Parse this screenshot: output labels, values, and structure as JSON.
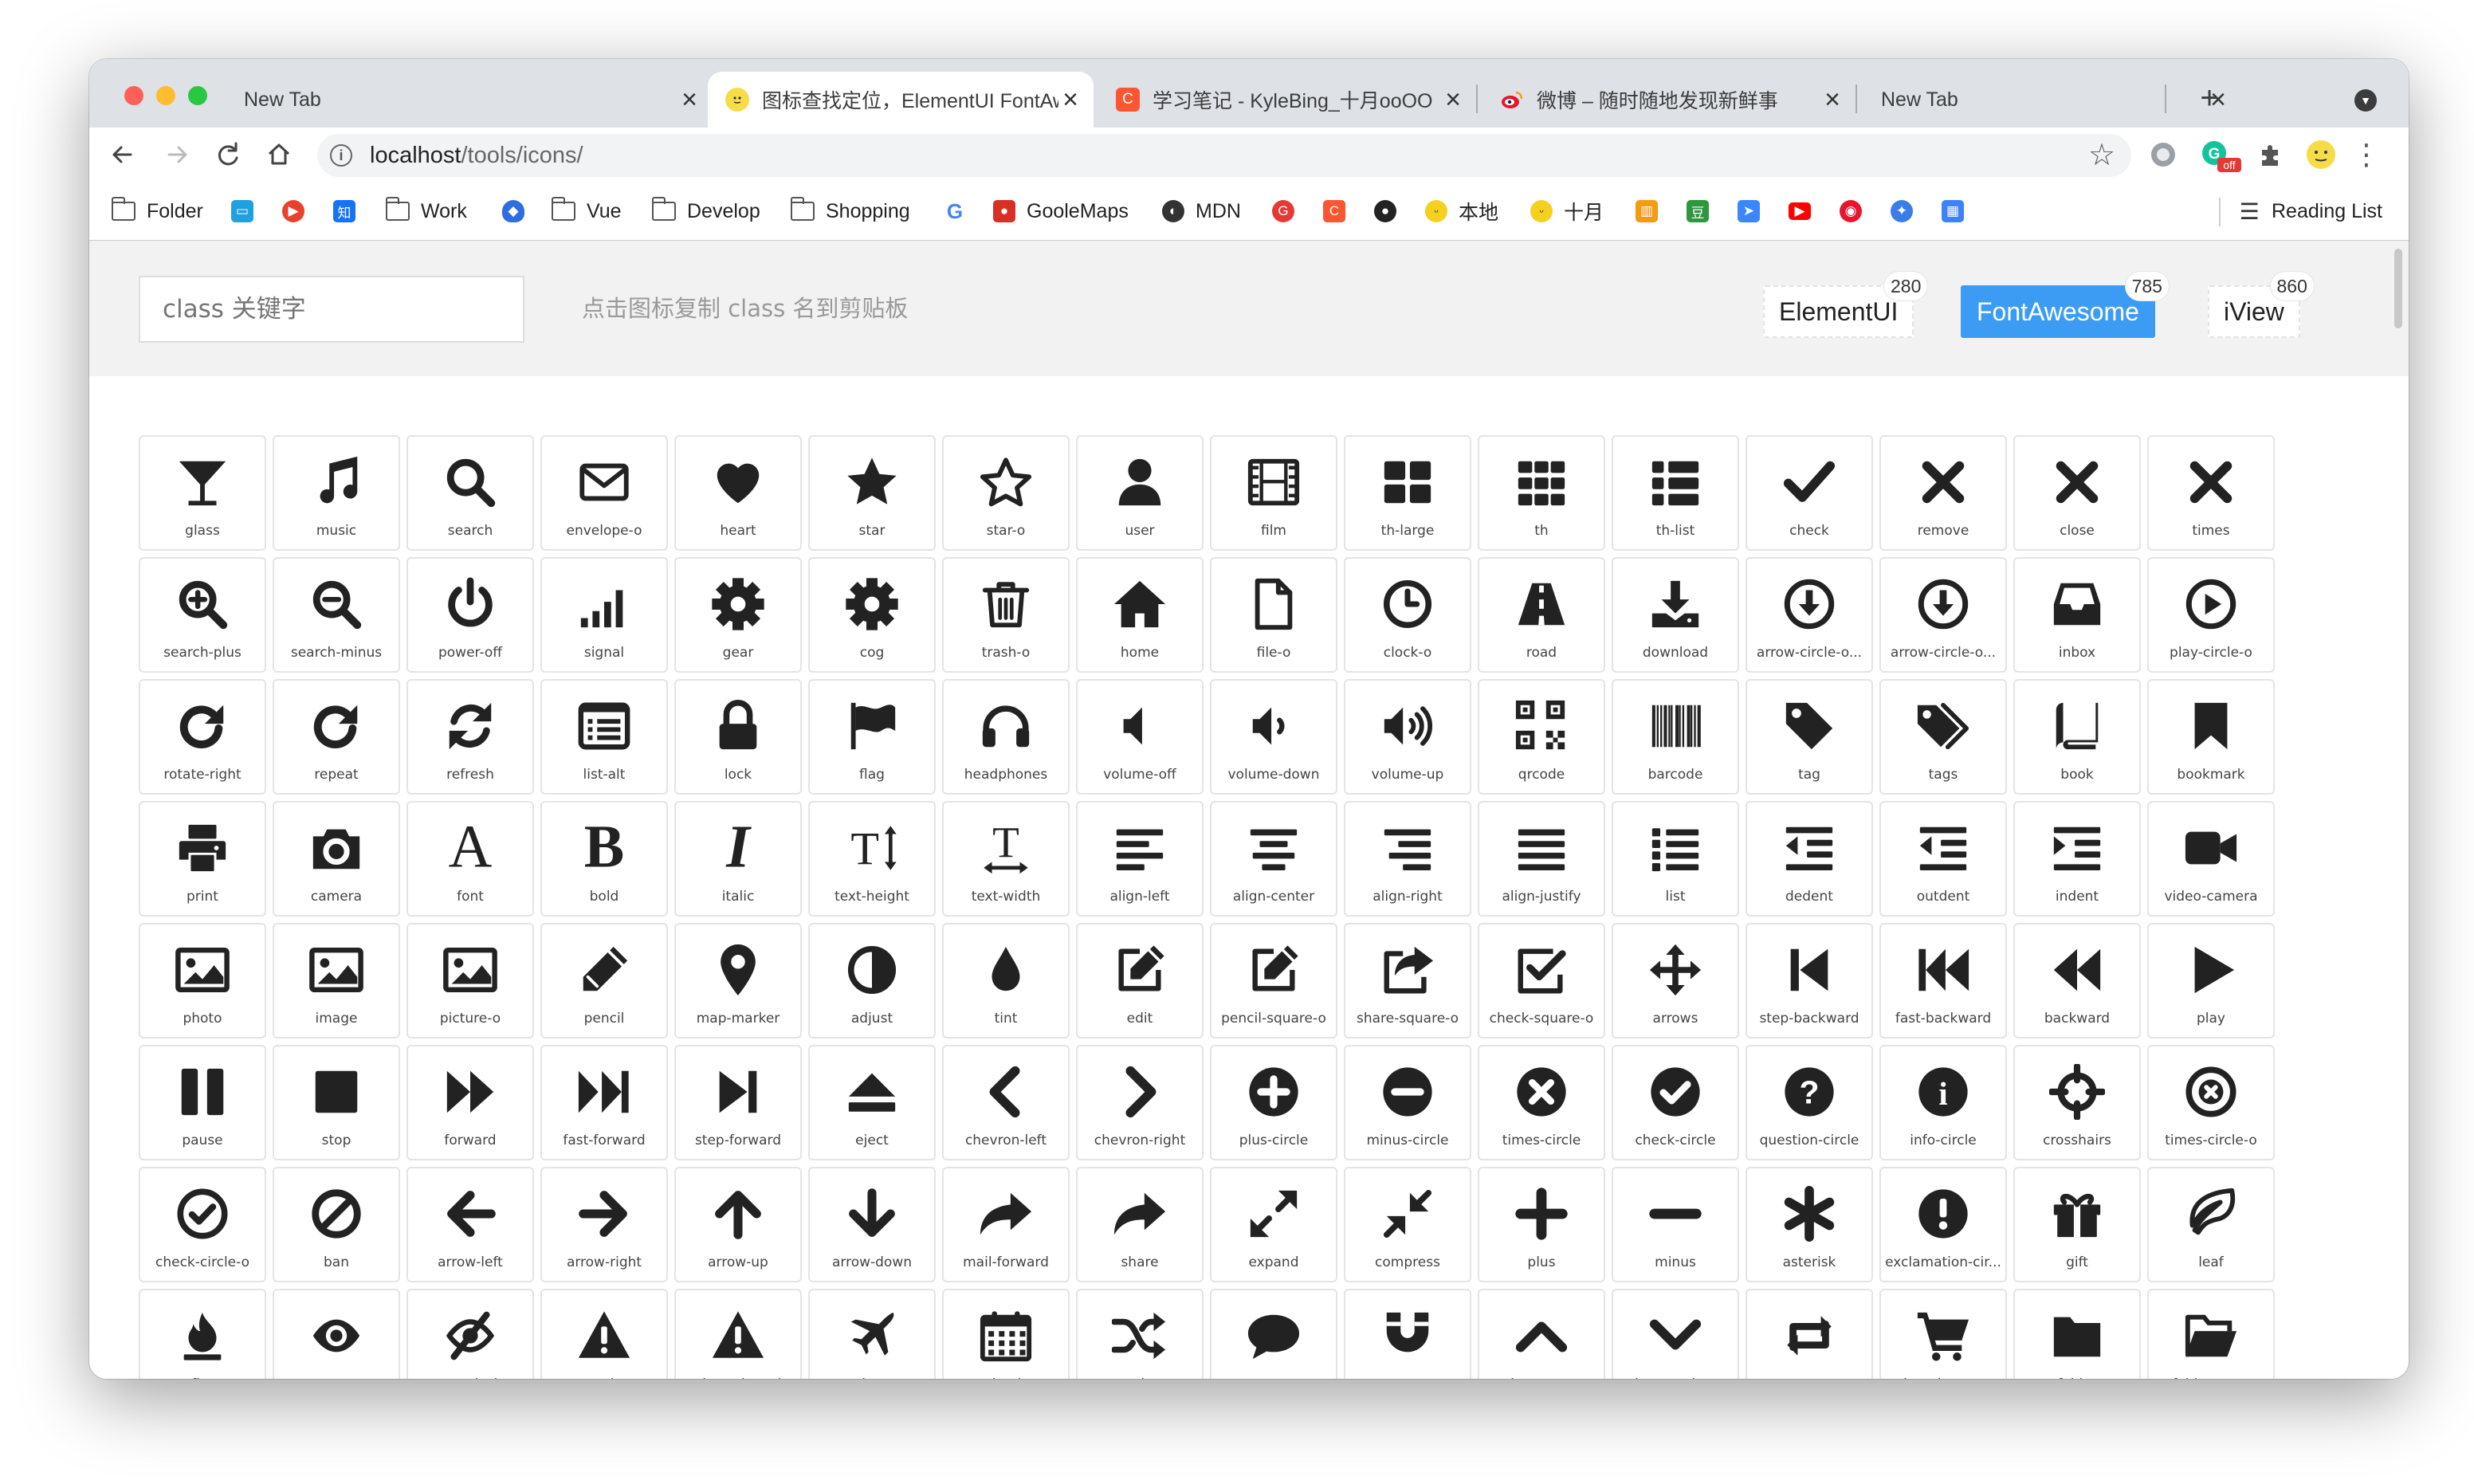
{
  "browser": {
    "tabs": [
      {
        "title": "New Tab",
        "favicon": "none",
        "active": false
      },
      {
        "title": "图标查找定位，ElementUI FontAwesome",
        "favicon": "emoji-face-icon",
        "active": true
      },
      {
        "title": "学习笔记 - KyleBing_十月ooOO",
        "favicon": "csdn-c-icon",
        "active": false
      },
      {
        "title": "微博 – 随时随地发现新鲜事",
        "favicon": "weibo-icon",
        "active": false
      },
      {
        "title": "New Tab",
        "favicon": "none",
        "active": false
      }
    ],
    "url_host": "localhost",
    "url_path": "/tools/icons/",
    "ext_badge": "off",
    "bookmarks": [
      {
        "label": "Folder",
        "icon": "folder-icon"
      },
      {
        "label": "",
        "icon": "bilibili-icon",
        "color": "#20a0e0"
      },
      {
        "label": "",
        "icon": "play-red-icon",
        "color": "#e8412c"
      },
      {
        "label": "",
        "icon": "zhihu-icon",
        "color": "#1772f6",
        "glyph": "知"
      },
      {
        "label": "Work",
        "icon": "folder-icon"
      },
      {
        "label": "",
        "icon": "shield-blue-icon",
        "color": "#2f6ee0"
      },
      {
        "label": "Vue",
        "icon": "folder-icon"
      },
      {
        "label": "Develop",
        "icon": "folder-icon"
      },
      {
        "label": "Shopping",
        "icon": "folder-icon"
      },
      {
        "label": "",
        "icon": "google-g-icon",
        "color": "#4285f4",
        "glyph": "G"
      },
      {
        "label": "GooleMaps",
        "icon": "maps-pin-icon",
        "color": "#d93025"
      },
      {
        "label": "MDN",
        "icon": "globe-icon",
        "color": "#333"
      },
      {
        "label": "",
        "icon": "g-red-icon",
        "color": "#e53935",
        "glyph": "G"
      },
      {
        "label": "",
        "icon": "csdn-c-icon",
        "color": "#fc5531",
        "glyph": "C"
      },
      {
        "label": "",
        "icon": "github-icon",
        "color": "#222"
      },
      {
        "label": "本地",
        "icon": "emoji-face-icon",
        "color": "#f5d020"
      },
      {
        "label": "十月",
        "icon": "emoji-face-icon",
        "color": "#f5d020"
      },
      {
        "label": "",
        "icon": "book-orange-icon",
        "color": "#f39c12"
      },
      {
        "label": "",
        "icon": "douban-icon",
        "color": "#2e963d",
        "glyph": "豆"
      },
      {
        "label": "",
        "icon": "send-blue-icon",
        "color": "#3a86ff"
      },
      {
        "label": "",
        "icon": "youtube-icon",
        "color": "#ff0000"
      },
      {
        "label": "",
        "icon": "weibo-icon",
        "color": "#e6162d"
      },
      {
        "label": "",
        "icon": "cube-icon",
        "color": "#3b7de8"
      },
      {
        "label": "",
        "icon": "chart-icon",
        "color": "#3e82f7"
      }
    ],
    "reading_list": "Reading List"
  },
  "page": {
    "search_placeholder": "class 关键字",
    "hint": "点击图标复制 class 名到剪贴板",
    "libraries": [
      {
        "label": "ElementUI",
        "count": "280",
        "active": false
      },
      {
        "label": "FontAwesome",
        "count": "785",
        "active": true
      },
      {
        "label": "iView",
        "count": "860",
        "active": false
      }
    ],
    "accent": "#3c9cf4",
    "icons": [
      "glass",
      "music",
      "search",
      "envelope-o",
      "heart",
      "star",
      "star-o",
      "user",
      "film",
      "th-large",
      "th",
      "th-list",
      "check",
      "remove",
      "close",
      "times",
      "search-plus",
      "search-minus",
      "power-off",
      "signal",
      "gear",
      "cog",
      "trash-o",
      "home",
      "file-o",
      "clock-o",
      "road",
      "download",
      "arrow-circle-o...",
      "arrow-circle-o...",
      "inbox",
      "play-circle-o",
      "rotate-right",
      "repeat",
      "refresh",
      "list-alt",
      "lock",
      "flag",
      "headphones",
      "volume-off",
      "volume-down",
      "volume-up",
      "qrcode",
      "barcode",
      "tag",
      "tags",
      "book",
      "bookmark",
      "print",
      "camera",
      "font",
      "bold",
      "italic",
      "text-height",
      "text-width",
      "align-left",
      "align-center",
      "align-right",
      "align-justify",
      "list",
      "dedent",
      "outdent",
      "indent",
      "video-camera",
      "photo",
      "image",
      "picture-o",
      "pencil",
      "map-marker",
      "adjust",
      "tint",
      "edit",
      "pencil-square-o",
      "share-square-o",
      "check-square-o",
      "arrows",
      "step-backward",
      "fast-backward",
      "backward",
      "play",
      "pause",
      "stop",
      "forward",
      "fast-forward",
      "step-forward",
      "eject",
      "chevron-left",
      "chevron-right",
      "plus-circle",
      "minus-circle",
      "times-circle",
      "check-circle",
      "question-circle",
      "info-circle",
      "crosshairs",
      "times-circle-o",
      "check-circle-o",
      "ban",
      "arrow-left",
      "arrow-right",
      "arrow-up",
      "arrow-down",
      "mail-forward",
      "share",
      "expand",
      "compress",
      "plus",
      "minus",
      "asterisk",
      "exclamation-cir...",
      "gift",
      "leaf",
      "fire",
      "eye",
      "eye-slash",
      "warning",
      "exclamation-triangle",
      "plane",
      "calendar",
      "random",
      "comment",
      "magnet",
      "chevron-up",
      "chevron-down",
      "retweet",
      "shopping-cart",
      "folder",
      "folder-open"
    ]
  }
}
